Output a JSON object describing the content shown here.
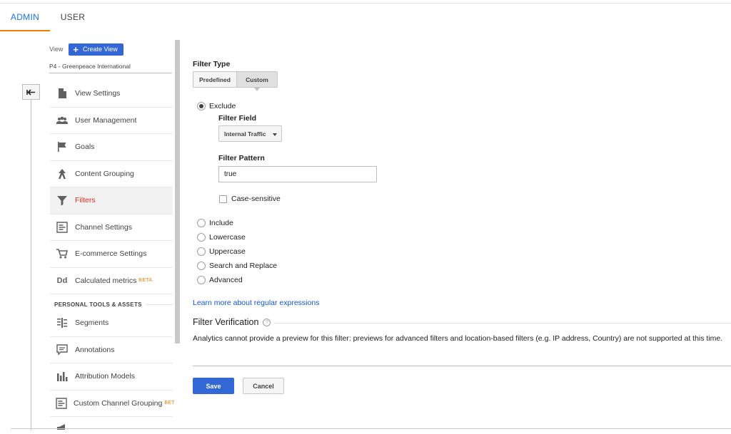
{
  "tabs": [
    {
      "label": "ADMIN",
      "active": true
    },
    {
      "label": "USER",
      "active": false
    }
  ],
  "view": {
    "label": "View",
    "create_button": "Create View",
    "name": "P4 - Greenpeace International"
  },
  "nav": {
    "items": [
      {
        "label": "View Settings",
        "icon": "document-icon"
      },
      {
        "label": "User Management",
        "icon": "people-icon"
      },
      {
        "label": "Goals",
        "icon": "flag-icon"
      },
      {
        "label": "Content Grouping",
        "icon": "content-grouping-icon"
      },
      {
        "label": "Filters",
        "icon": "filter-icon",
        "active": true
      },
      {
        "label": "Channel Settings",
        "icon": "channel-icon"
      },
      {
        "label": "E-commerce Settings",
        "icon": "cart-icon"
      },
      {
        "label": "Calculated metrics",
        "icon": "dd-icon",
        "badge": "BETA"
      }
    ],
    "section_title": "PERSONAL TOOLS & ASSETS",
    "personal_items": [
      {
        "label": "Segments",
        "icon": "segments-icon"
      },
      {
        "label": "Annotations",
        "icon": "annotation-icon"
      },
      {
        "label": "Attribution Models",
        "icon": "bar-chart-icon"
      },
      {
        "label": "Custom Channel Grouping",
        "icon": "channel-icon",
        "badge": "BET"
      }
    ]
  },
  "filter": {
    "type_label": "Filter Type",
    "type_options": [
      "Predefined",
      "Custom"
    ],
    "type_selected": "Custom",
    "exclude_label": "Exclude",
    "field_label": "Filter Field",
    "field_value": "Internal Traffic",
    "pattern_label": "Filter Pattern",
    "pattern_value": "true",
    "case_sensitive_label": "Case-sensitive",
    "case_sensitive_checked": false,
    "other_options": [
      "Include",
      "Lowercase",
      "Uppercase",
      "Search and Replace",
      "Advanced"
    ],
    "learn_more": "Learn more about regular expressions",
    "verification_title": "Filter Verification",
    "verification_text": "Analytics cannot provide a preview for this filter: previews for advanced filters and location-based filters (e.g. IP address, Country) are not supported at this time."
  },
  "actions": {
    "save": "Save",
    "cancel": "Cancel"
  },
  "colors": {
    "accent_blue": "#3367d6",
    "active_red": "#d93025",
    "tab_orange": "#f57c00",
    "link_blue": "#1155cc"
  }
}
